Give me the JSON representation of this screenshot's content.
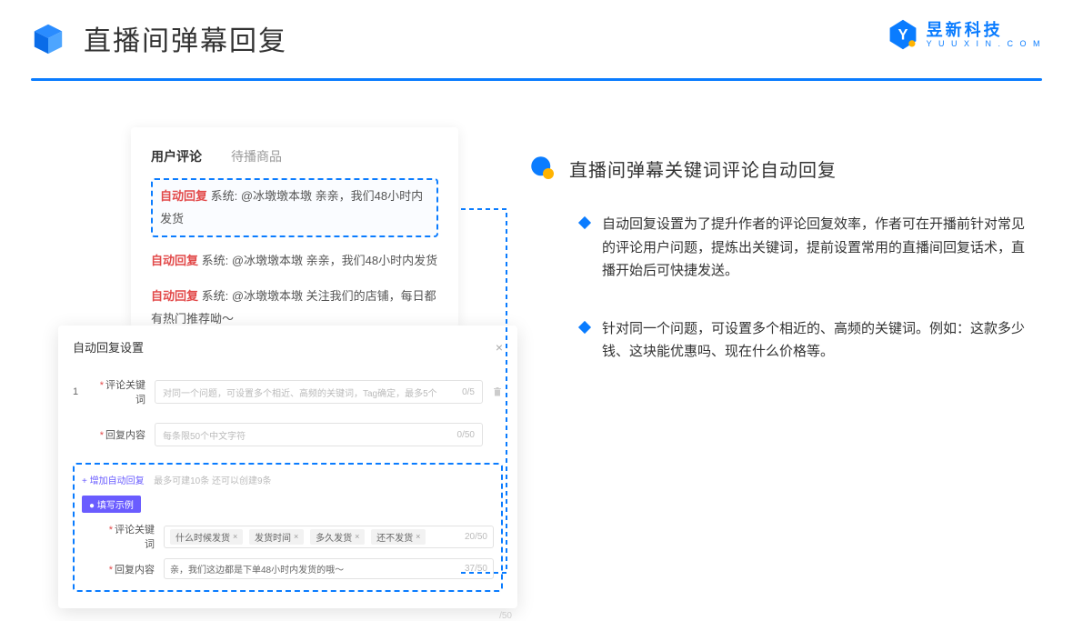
{
  "header": {
    "page_title": "直播间弹幕回复",
    "logo_cn": "昱新科技",
    "logo_en": "Y U U X I N . C O M"
  },
  "panelA": {
    "tabs": {
      "active": "用户评论",
      "other": "待播商品"
    },
    "comments": {
      "c0_tag": "自动回复",
      "c0_text": " 系统: @冰墩墩本墩 亲亲，我们48小时内发货",
      "c1_tag": "自动回复",
      "c1_text": " 系统: @冰墩墩本墩 亲亲，我们48小时内发货",
      "c2_tag": "自动回复",
      "c2_text": " 系统: @冰墩墩本墩 关注我们的店铺，每日都有热门推荐呦～"
    }
  },
  "panelB": {
    "dialog_title": "自动回复设置",
    "close": "×",
    "row_num": "1",
    "label_keyword": "评论关键词",
    "placeholder_keyword": "对同一个问题，可设置多个相近、高频的关键词，Tag确定，最多5个",
    "counter_keyword": "0/5",
    "label_reply": "回复内容",
    "placeholder_reply": "每条限50个中文字符",
    "counter_reply": "0/50",
    "add_link": "+ 增加自动回复",
    "add_note": "最多可建10条 还可以创建9条",
    "example_pill": "● 填写示例",
    "ex_label_keyword": "评论关键词",
    "ex_tags": {
      "t0": "什么时候发货",
      "t1": "发货时间",
      "t2": "多久发货",
      "t3": "还不发货"
    },
    "ex_counter_kw": "20/50",
    "ex_label_reply": "回复内容",
    "ex_reply_value": "亲，我们这边都是下单48小时内发货的哦～",
    "ex_counter_reply": "37/50",
    "bottom_counter": "/50"
  },
  "right": {
    "title": "直播间弹幕关键词评论自动回复",
    "bullet1": "自动回复设置为了提升作者的评论回复效率，作者可在开播前针对常见的评论用户问题，提炼出关键词，提前设置常用的直播间回复话术，直播开始后可快捷发送。",
    "bullet2": "针对同一个问题，可设置多个相近的、高频的关键词。例如：这款多少钱、这块能优惠吗、现在什么价格等。"
  }
}
